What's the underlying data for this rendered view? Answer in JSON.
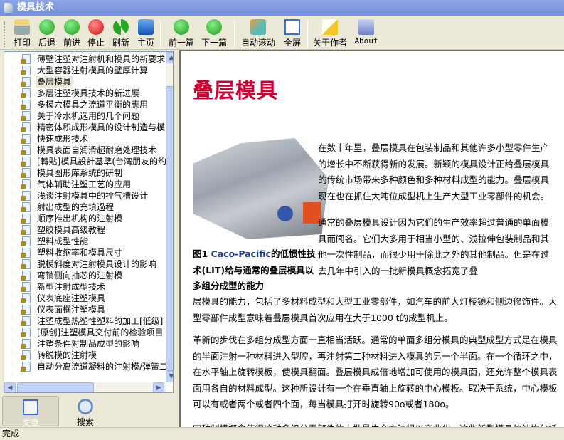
{
  "window": {
    "title": "模具技术"
  },
  "toolbar": {
    "buttons": [
      {
        "label": "打印",
        "icon": "printer-icon"
      },
      {
        "label": "后退",
        "icon": "back-arrow-icon"
      },
      {
        "label": "前进",
        "icon": "forward-arrow-icon"
      },
      {
        "label": "停止",
        "icon": "stop-icon"
      },
      {
        "label": "刷新",
        "icon": "refresh-icon"
      },
      {
        "label": "主页",
        "icon": "home-icon"
      },
      {
        "label": "前一篇",
        "icon": "up-arrow-icon"
      },
      {
        "label": "下一篇",
        "icon": "down-arrow-icon"
      },
      {
        "label": "自动滚动",
        "icon": "auto-scroll-icon"
      },
      {
        "label": "全屏",
        "icon": "fullscreen-icon"
      },
      {
        "label": "关于作者",
        "icon": "author-icon"
      },
      {
        "label": "About",
        "icon": "book-icon"
      }
    ]
  },
  "tree": {
    "selected": "叠层模具",
    "items": [
      "薄壁注塑对注射机和模具的新要求",
      "大型容器注射模具的壁厚计算",
      "叠层模具",
      "多层注塑模具技术的新进展",
      "多模穴模具之流道平衡的應用",
      "关于冷水机选用的几个问题",
      "精密体积成形模具的设计制造与模",
      "快速成形技术",
      "模具表面自润滑超耐磨处理技术",
      "[轉貼]模具設計基準(台湾朋友的约",
      "模具图形库系统的研制",
      "气体辅助注塑工艺的应用",
      "浅谈注射模具中的排气槽设计",
      "射出成型的充填過程",
      "顺序推出机构的注射模",
      "塑胶模具高级教程",
      "塑料成型性能",
      "塑料收缩率和模具尺寸",
      "脱模斜度对注射模具设计的影响",
      "弯销侧向抽芯的注射模",
      "新型注射成型技术",
      "仪表底座注塑模具",
      "仪表面框注塑模具",
      "注塑成型热塑性塑料的加工[低级]",
      "[原创]注塑模具交付前的检验项目",
      "注塑条件对制品成型的影响",
      "转脱模的注射模",
      "自动分离流道凝料的注射模/弹簧二"
    ]
  },
  "tabs": [
    {
      "label": "文章",
      "icon": "article-icon",
      "active": true
    },
    {
      "label": "搜索",
      "icon": "magnifier-icon",
      "active": false
    }
  ],
  "status": "完成",
  "article": {
    "title": "叠层模具",
    "title_color": "#cc0033",
    "p1": "在数十年里，叠层模具在包装制品和其他许多小型零件生产的增长中不断获得新的发展。新颖的模具设计正给叠层模具的传统市场带来多种颜色和多种材料成型的能力。叠层模具现在也在抓住大吨位成型机上生产大型工业零部件的机会。",
    "p2": "通常的叠层模具设计因为它们的生产效率超过普通的单面模具而闻名。它们大多用于相当小型的、浅拉伸包装制品和其他一次性制品，而很少用于除此之外的其他制品。但是在过去几年中引入的一批新模具概念拓宽了叠",
    "caption_prefix": "图1 ",
    "caption_brand": "Caco-Pacific",
    "caption_rest": "的低惯性技术(LIT)给与通常的叠层模具以多组分成型的能力",
    "p3": "层模具的能力，包括了多材料成型和大型工业零部件，如汽车的前大灯棱镜和侧边修饰件。大型零部件成型意味着叠层模具首次应用在大于1000 t的成型机上。",
    "p4": "革新的步伐在多组分成型方面一直相当活跃。通常的单面多组分模具的典型成型方式是在模具的半面注射一种材料进入型腔，再注射第二种材料进入模具的另一个半面。在一个循环之中，在水平轴上旋转模板，使模具翻面。叠层模具成倍地增加可使用的模具面，还允许整个模具表面用各自的材料成型。这种新设计有一个在垂直轴上旋转的中心模板。取决于系统，中心模板可以有或者两个或者四个面，每当模具打开时旋转90o或者180o。",
    "p5": "四种制模概念使得这种多组分零部件的大批量生产方法得以商业化。这些新型模具的结构包括"
  }
}
